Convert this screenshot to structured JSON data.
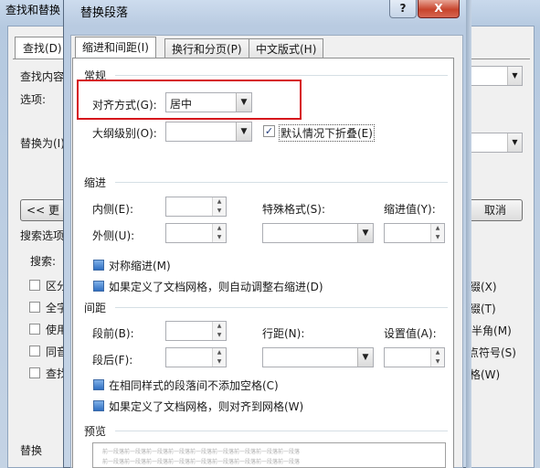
{
  "bg_window": {
    "title": "查找和替换",
    "tab_find": "查找(D)",
    "find_content_label": "查找内容",
    "options_label": "选项:",
    "replace_with_label": "替换为(I)",
    "less_button": "<< 更",
    "search_options_label": "搜索选项",
    "search_label": "搜索:",
    "cb_rows": [
      "区分",
      "全字",
      "使用",
      "同音",
      "查找"
    ],
    "right_options": [
      "缀(X)",
      "缀(T)",
      "/半角(M)",
      "点符号(S)",
      "格(W)"
    ],
    "cancel_button": "取消",
    "replace_section": "替换"
  },
  "window_buttons": {
    "help": "?",
    "close": "X"
  },
  "dialog": {
    "title": "替换段落",
    "tabs": [
      "缩进和间距(I)",
      "换行和分页(P)",
      "中文版式(H)"
    ],
    "general": {
      "title": "常规",
      "alignment_label": "对齐方式(G):",
      "alignment_value": "居中",
      "outline_label": "大纲级别(O):",
      "outline_value": "",
      "collapse_label": "默认情况下折叠(E)",
      "collapse_checked": "✓"
    },
    "indent": {
      "title": "缩进",
      "inside_label": "内侧(E):",
      "outside_label": "外侧(U):",
      "special_label": "特殊格式(S):",
      "indent_value_label": "缩进值(Y):",
      "mirror_label": "对称缩进(M)",
      "auto_adjust_label": "如果定义了文档网格，则自动调整右缩进(D)"
    },
    "spacing": {
      "title": "间距",
      "before_label": "段前(B):",
      "after_label": "段后(F):",
      "line_label": "行距(N):",
      "setting_label": "设置值(A):",
      "no_space_label": "在相同样式的段落间不添加空格(C)",
      "snap_grid_label": "如果定义了文档网格，则对齐到网格(W)"
    },
    "preview": {
      "title": "预览",
      "sample_text": "前一段落前一段落前一段落前一段落前一段落前一段落前一段落前一段落前一段落"
    }
  }
}
